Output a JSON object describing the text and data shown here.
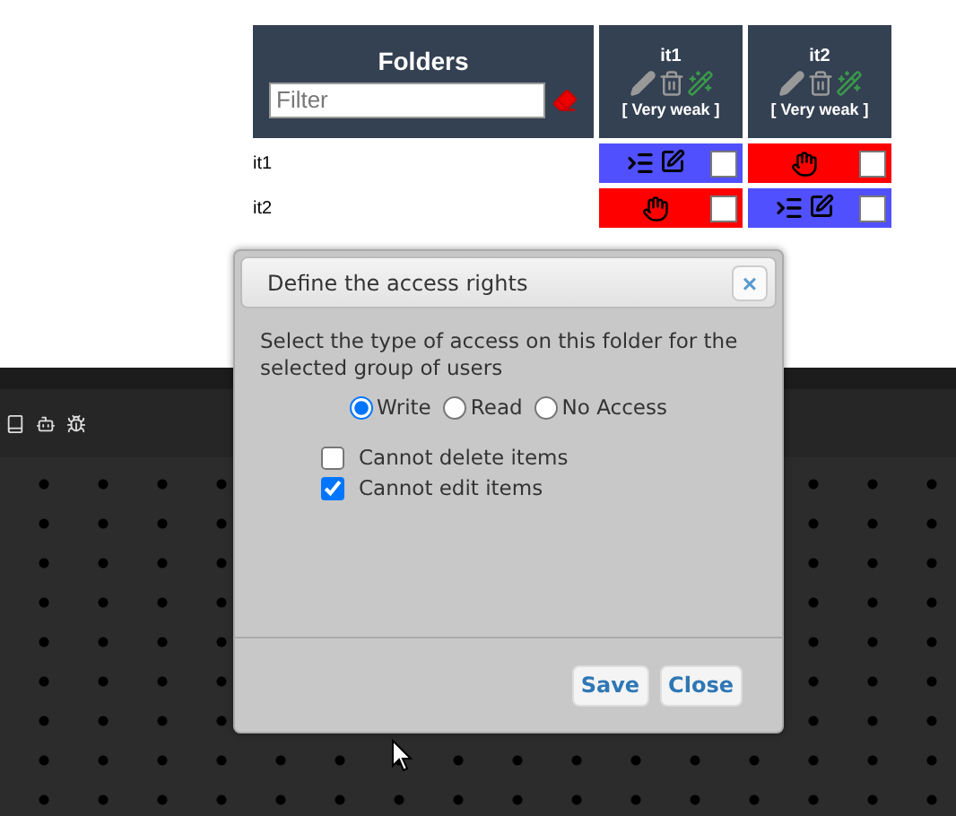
{
  "table": {
    "title": "Folders",
    "filter": {
      "placeholder": "Filter"
    },
    "columns": [
      {
        "name": "it1",
        "strength": "[ Very weak ]"
      },
      {
        "name": "it2",
        "strength": "[ Very weak ]"
      }
    ],
    "rows": [
      {
        "label": "it1",
        "cells": [
          {
            "kind": "write",
            "color": "#5050ff",
            "checked": false
          },
          {
            "kind": "none",
            "color": "#ff0000",
            "checked": false
          }
        ]
      },
      {
        "label": "it2",
        "cells": [
          {
            "kind": "none",
            "color": "#ff0000",
            "checked": false
          },
          {
            "kind": "write",
            "color": "#5050ff",
            "checked": false
          }
        ]
      }
    ]
  },
  "dialog": {
    "title": "Define the access rights",
    "close": "×",
    "message": "Select the type of access on this folder for the selected group of users",
    "access_options": [
      {
        "label": "Write",
        "selected": true
      },
      {
        "label": "Read",
        "selected": false
      },
      {
        "label": "No Access",
        "selected": false
      }
    ],
    "options": [
      {
        "label": "Cannot delete items",
        "checked": false
      },
      {
        "label": "Cannot edit items",
        "checked": true
      }
    ],
    "buttons": [
      "Save",
      "Close"
    ]
  }
}
